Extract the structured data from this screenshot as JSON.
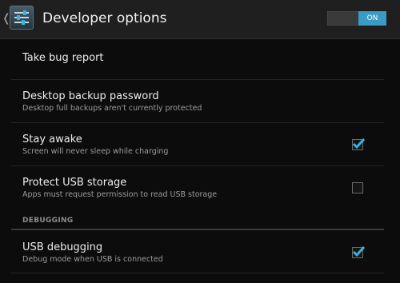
{
  "header": {
    "title": "Developer options",
    "master_switch": {
      "label": "ON",
      "state": "on"
    },
    "icons": {
      "up": "chevron-left-icon",
      "app": "developer-settings-icon"
    }
  },
  "preferences": [
    {
      "title": "Take bug report"
    },
    {
      "title": "Desktop backup password",
      "summary": "Desktop full backups aren't currently protected"
    },
    {
      "title": "Stay awake",
      "summary": "Screen will never sleep while charging",
      "checked": true
    },
    {
      "title": "Protect USB storage",
      "summary": "Apps must request permission to read USB storage",
      "checked": false
    }
  ],
  "debugging": {
    "header": "DEBUGGING",
    "preferences": [
      {
        "title": "USB debugging",
        "summary": "Debug mode when USB is connected",
        "checked": true
      }
    ]
  },
  "colors": {
    "accent": "#3a9bc4",
    "checkmark": "#33b5e5",
    "background": "#0c0c0c",
    "action_bar": "#1f1f1f"
  }
}
